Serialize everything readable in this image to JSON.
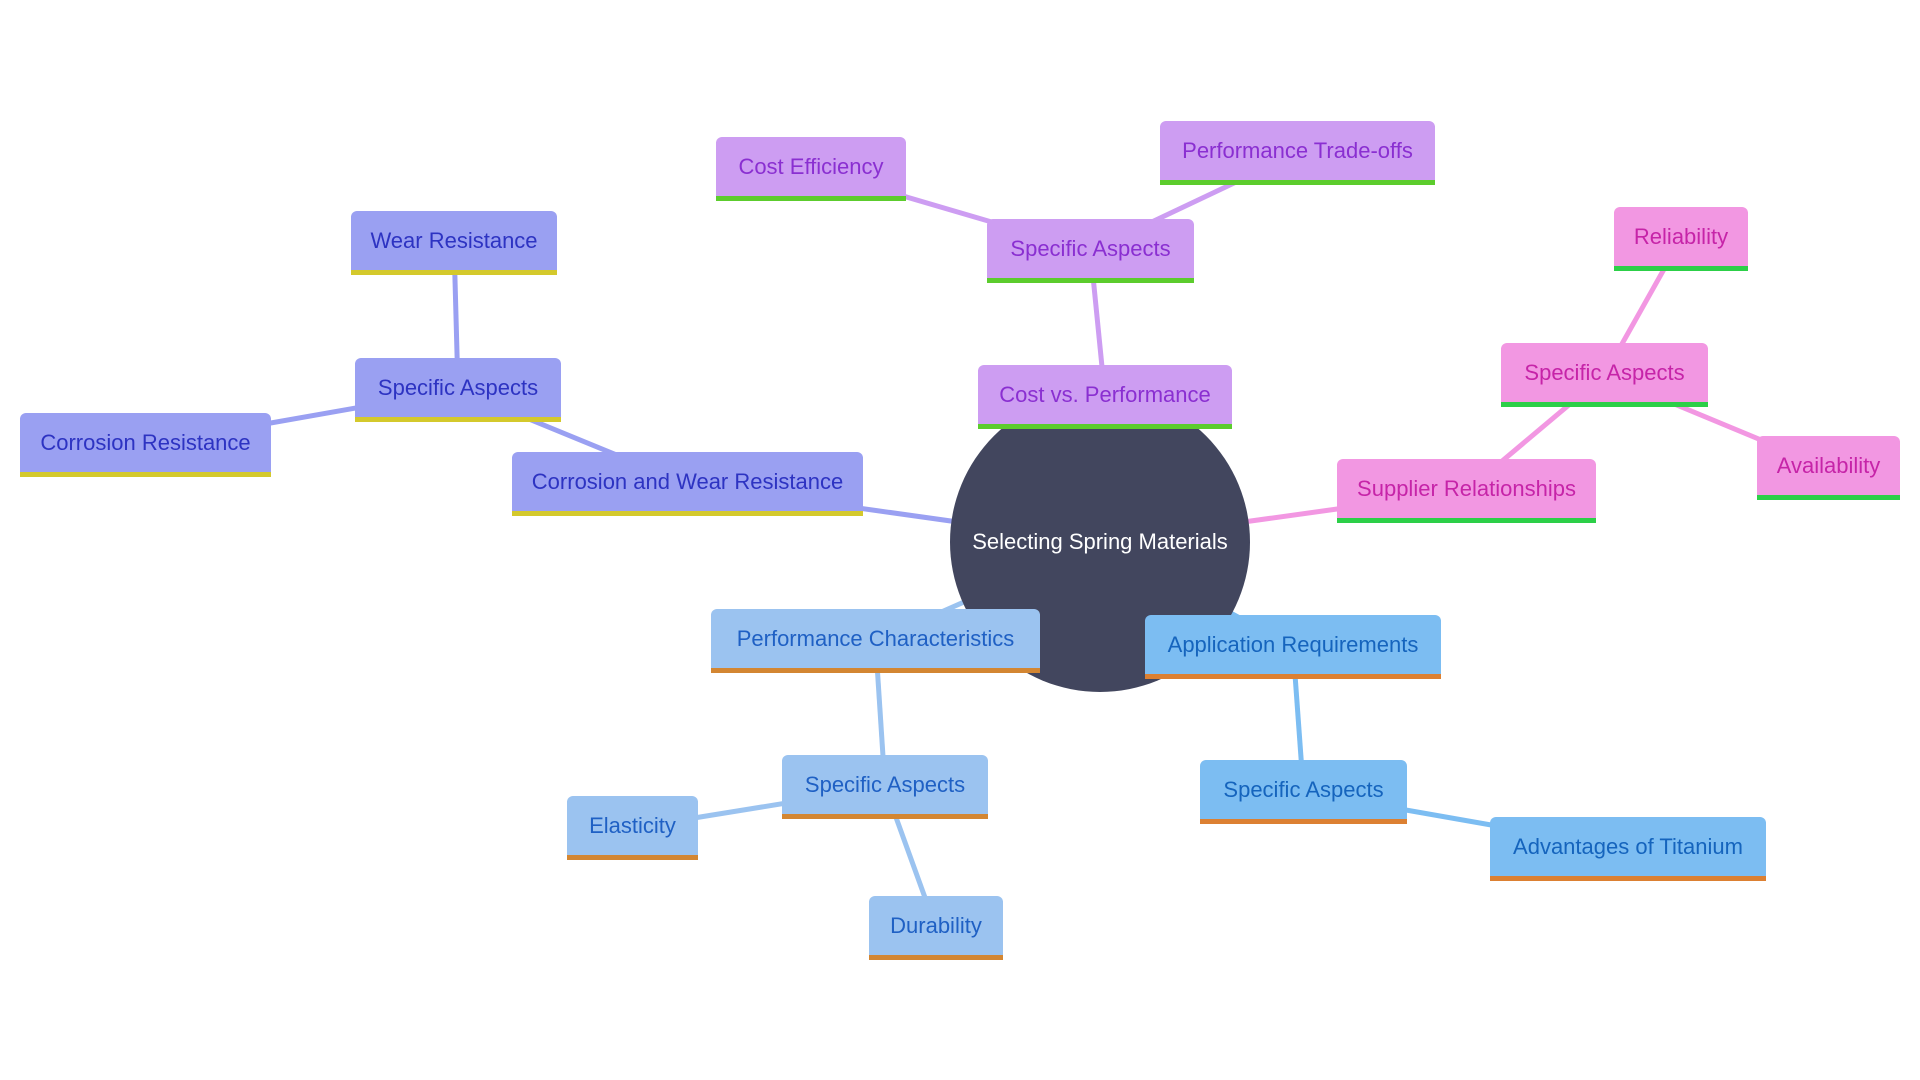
{
  "title": "Selecting Spring Materials",
  "colors": {
    "root_fill": "#42465e",
    "purple_edge": "#cd9df2",
    "indigo_edge": "#9aa0f2",
    "pink_edge": "#f297e2",
    "lblue_edge": "#9bc3f0",
    "blue_edge": "#7cbdf2"
  },
  "branches": {
    "cost": {
      "label": "Cost vs. Performance",
      "aspects": "Specific Aspects",
      "children": [
        "Cost Efficiency",
        "Performance Trade-offs"
      ]
    },
    "corrosion": {
      "label": "Corrosion and Wear Resistance",
      "aspects": "Specific Aspects",
      "children": [
        "Wear Resistance",
        "Corrosion Resistance"
      ]
    },
    "supplier": {
      "label": "Supplier Relationships",
      "aspects": "Specific Aspects",
      "children": [
        "Reliability",
        "Availability"
      ]
    },
    "performance": {
      "label": "Performance Characteristics",
      "aspects": "Specific Aspects",
      "children": [
        "Elasticity",
        "Durability"
      ]
    },
    "application": {
      "label": "Application Requirements",
      "aspects": "Specific Aspects",
      "children": [
        "Advantages of Titanium"
      ]
    }
  }
}
